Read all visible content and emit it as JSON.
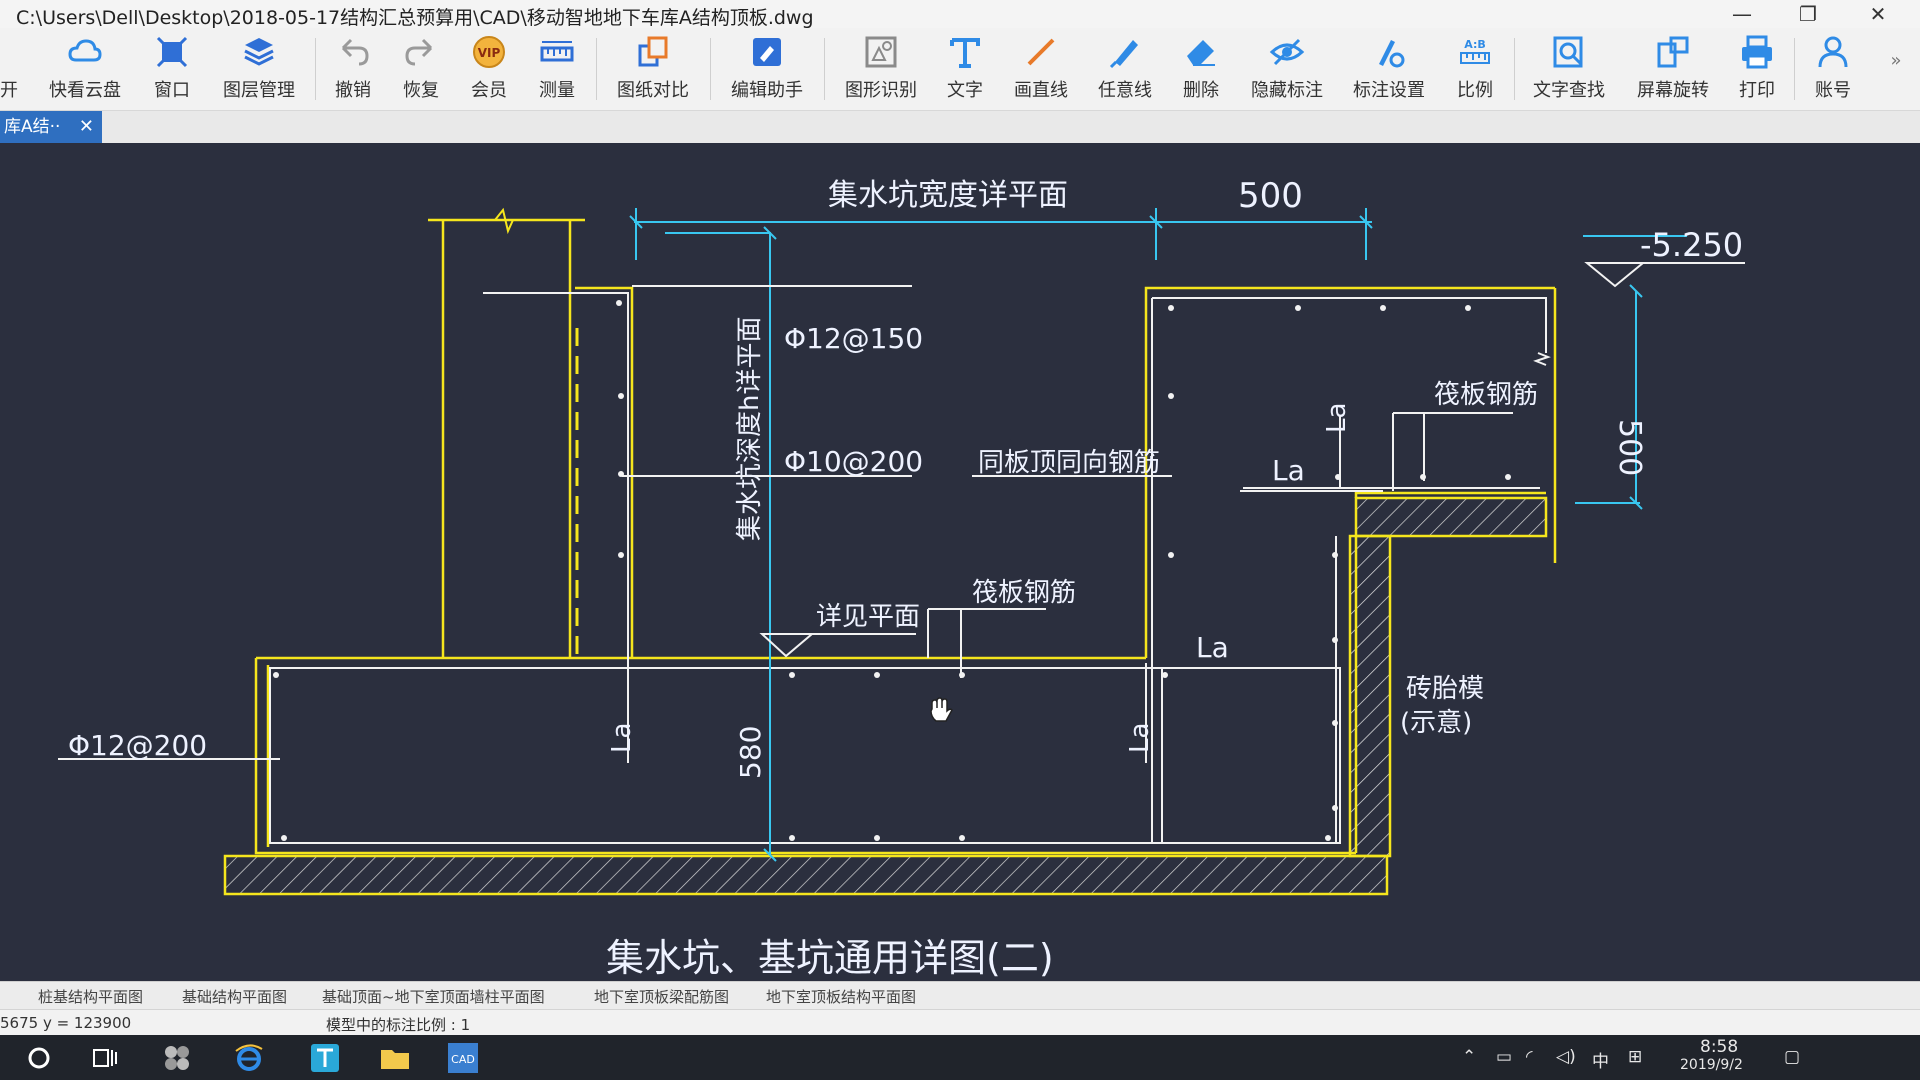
{
  "window": {
    "title": "C:\\Users\\Dell\\Desktop\\2018-05-17结构汇总预算用\\CAD\\移动智地地下车库A结构顶板.dwg",
    "minimize": "—",
    "restore": "❐",
    "close": "✕"
  },
  "toolbar": {
    "open": "开",
    "items": [
      {
        "label": "快看云盘",
        "icon": "cloud-icon"
      },
      {
        "label": "窗口",
        "icon": "window-icon"
      },
      {
        "label": "图层管理",
        "icon": "layers-icon"
      },
      {
        "label": "撤销",
        "icon": "undo-icon"
      },
      {
        "label": "恢复",
        "icon": "redo-icon"
      },
      {
        "label": "会员",
        "icon": "vip-icon"
      },
      {
        "label": "测量",
        "icon": "ruler-icon"
      },
      {
        "label": "图纸对比",
        "icon": "compare-icon"
      },
      {
        "label": "编辑助手",
        "icon": "edit-assistant-icon"
      },
      {
        "label": "图形识别",
        "icon": "shape-recognize-icon"
      },
      {
        "label": "文字",
        "icon": "text-icon"
      },
      {
        "label": "画直线",
        "icon": "line-icon"
      },
      {
        "label": "任意线",
        "icon": "freehand-icon"
      },
      {
        "label": "删除",
        "icon": "eraser-icon"
      },
      {
        "label": "隐藏标注",
        "icon": "hide-eye-icon"
      },
      {
        "label": "标注设置",
        "icon": "annotation-settings-icon"
      },
      {
        "label": "比例",
        "icon": "scale-icon"
      },
      {
        "label": "文字查找",
        "icon": "text-search-icon"
      },
      {
        "label": "屏幕旋转",
        "icon": "rotate-screen-icon"
      },
      {
        "label": "打印",
        "icon": "print-icon"
      },
      {
        "label": "账号",
        "icon": "account-icon"
      }
    ],
    "more": "»"
  },
  "doc_tab": {
    "label": "库A结··",
    "close": "✕"
  },
  "drawing": {
    "title_top": "集水坑宽度详平面",
    "dim_500_top": "500",
    "elev": "-5.250",
    "rebar_150": "Φ12@150",
    "rebar_200": "Φ10@200",
    "rebar_left": "Φ12@200",
    "same_as_top": "同板顶同向钢筋",
    "raft_rebar_1": "筏板钢筋",
    "raft_rebar_2": "筏板钢筋",
    "see_plan": "详见平面",
    "pit_depth": "集水坑深度h详平面",
    "dim_500_right": "500",
    "dim_580": "580",
    "la": "La",
    "brick_1": "砖胎模",
    "brick_2": "(示意)",
    "main_title": "集水坑、基坑通用详图(二)",
    "colors": {
      "yellow": "#f5e61d",
      "white": "#f2f2f2",
      "cyan": "#39c7f0",
      "background": "#2b2f3e"
    }
  },
  "layout_tabs": [
    "桩基结构平面图",
    "基础结构平面图",
    "基础顶面~地下室顶面墙柱平面图",
    "地下室顶板梁配筋图",
    "地下室顶板结构平面图"
  ],
  "status": {
    "coords": "5675  y = 123900",
    "scale": "模型中的标注比例 : 1"
  },
  "taskbar": {
    "clock": "8:58",
    "date": "2019/9/2",
    "ime": "中"
  }
}
